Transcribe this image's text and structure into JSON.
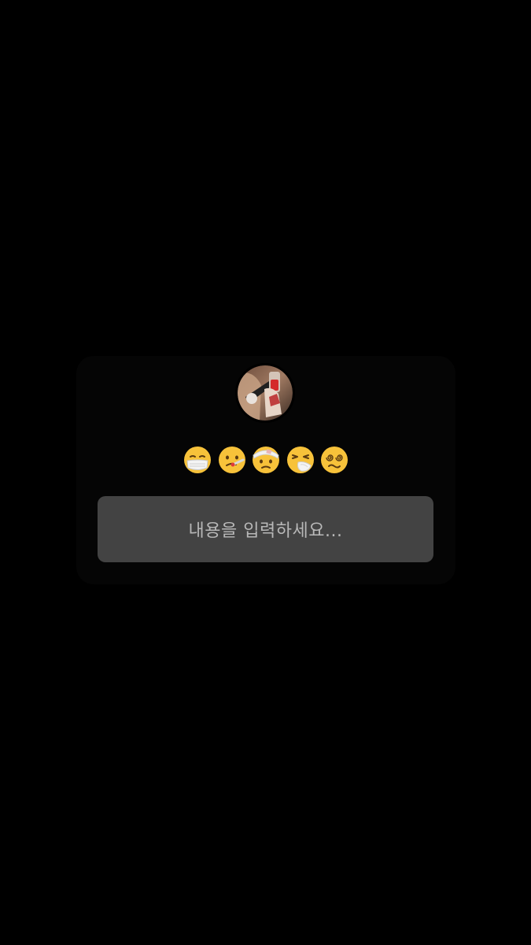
{
  "story_reply": {
    "avatar": {
      "icon": "user-photo-avatar"
    },
    "reactions": [
      {
        "icon": "face-with-medical-mask-emoji",
        "label": "😷"
      },
      {
        "icon": "face-with-thermometer-emoji",
        "label": "🤒"
      },
      {
        "icon": "face-with-head-bandage-emoji",
        "label": "🤕"
      },
      {
        "icon": "sneezing-face-emoji",
        "label": "🤧"
      },
      {
        "icon": "dizzy-face-emoji",
        "label": "😵‍💫"
      }
    ],
    "input": {
      "placeholder": "내용을 입력하세요...",
      "value": ""
    }
  },
  "colors": {
    "background": "#000000",
    "input_background": "#434343",
    "placeholder_text": "#b8b8b8",
    "emoji_yellow": "#f7c23a"
  }
}
